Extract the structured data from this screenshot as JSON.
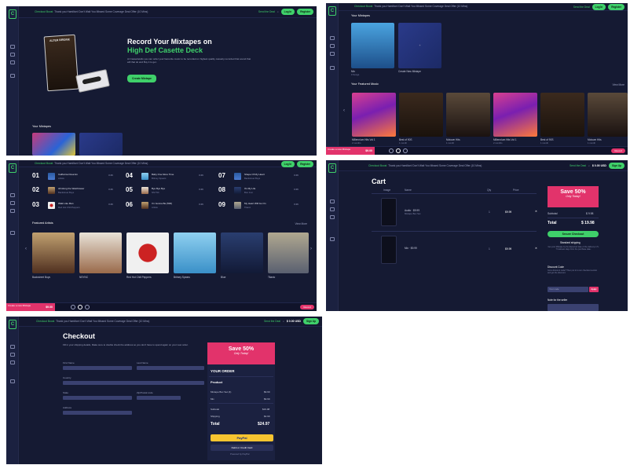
{
  "topbar": {
    "promo_prefix": "Checkout Boost",
    "promo_text": "Thank you Hamilton! Don't Wait You Missed Some Coverage Deal Offer (10 Mins)",
    "promo_long": "Checkout Boost · Thank you Hamilton! Don't Wait You Missed Some Coverage Deal Offer (10 Mins)",
    "link": "Send the Deal",
    "login": "Log In",
    "register": "Register",
    "currency": "$ 0.00 USD",
    "sign_up": "Sign Up"
  },
  "sidebar": {
    "logo": "C"
  },
  "screen1": {
    "album_title": "ALTER BRIDGE",
    "heading_line1": "Record Your Mixtapes on",
    "heading_line2": "High Def Casette Deck",
    "description": "At CassetteHits you can order your favourite music to be recorded on highest quality cassetty recorded that sound that will that do and Buy it to get.",
    "cta": "Create Mixtape",
    "your_mixtapes": "Your Mixtapes"
  },
  "screen2": {
    "your_mixtapes": "Your Mixtapes",
    "mixtape1_name": "Mix",
    "mixtape1_sub": "0 Songs",
    "create_label": "Create New Mixtape",
    "featured_title": "Your Featured Music",
    "view_more": "View More",
    "albums": [
      {
        "name": "Millennium Hits Vol 1",
        "sub": "2 months"
      },
      {
        "name": "Best of 90S",
        "sub": "1 month"
      },
      {
        "name": "Motown Hits",
        "sub": "1 month"
      },
      {
        "name": "Millennium Hits Vol 1",
        "sub": "2 months"
      },
      {
        "name": "Best of 90S",
        "sub": "1 month"
      },
      {
        "name": "Motown Hits",
        "sub": "1 month"
      }
    ],
    "player_label": "Create a new Mixtape",
    "player_price": "$9.00",
    "player_button": "Record"
  },
  "screen3": {
    "tracks": [
      {
        "num": "01",
        "title": "California Dreamin",
        "artist": "Artists"
      },
      {
        "num": "02",
        "title": "All Along the Watchtower",
        "artist": "Backstreet Boys"
      },
      {
        "num": "03",
        "title": "Walk Like Man",
        "artist": "Red Hot Chili Peppers"
      },
      {
        "num": "04",
        "title": "Baby One More Time",
        "artist": "Britney Spears"
      },
      {
        "num": "05",
        "title": "Bye Bye Bye",
        "artist": "NSYNC"
      },
      {
        "num": "06",
        "title": "I'm Gonna Be (500)",
        "artist": "Artists"
      },
      {
        "num": "07",
        "title": "Shape Of My Heart",
        "artist": "Backstreet Boys"
      },
      {
        "num": "08",
        "title": "It's My Life",
        "artist": "Bon Jovi"
      },
      {
        "num": "09",
        "title": "My Heart Will Go On",
        "artist": "Titanic"
      }
    ],
    "track_meta": "3:46",
    "featured_artists": "Featured Artists",
    "view_more": "View More",
    "artists": [
      "Backstreet Boys",
      "NSYNC",
      "Red Hot Chili Peppers",
      "Britney Spears",
      "Blue",
      "Titanic"
    ],
    "player_label": "Create a new Mixtape",
    "player_price": "$9.00",
    "player_button": "Record"
  },
  "screen4": {
    "title": "Cart",
    "col_image": "Image",
    "col_name": "Name",
    "col_qty": "Qty",
    "col_price": "Price",
    "items": [
      {
        "name": "Audio · $9.99",
        "sub": "Mixtape Box Set",
        "qty": "1",
        "price": "$9.99"
      },
      {
        "name": "Mix · $9.99",
        "sub": "",
        "qty": "1",
        "price": "$9.99"
      }
    ],
    "promo_big": "Save 50%",
    "promo_small": "Only Today!",
    "subtotal_label": "Subtotal",
    "subtotal_value": "$ 9.98",
    "total_label": "Total",
    "total_value": "$ 19.98",
    "checkout_button": "Secure Checkout",
    "shipping_title": "Standard shipping",
    "shipping_desc": "Get your Mixtape by the Expected date of the delivery in 5-7 business days from the purchase date.",
    "discount_title": "Discount Code",
    "discount_desc": "Got a discount code? Then put in to our checkout section and get the discount.",
    "discount_placeholder": "Your code",
    "discount_apply": "Apply",
    "note_title": "Note for the seller"
  },
  "screen5": {
    "title": "Checkout",
    "intro": "Fill in your shipping details, Make sure to double check the address so you don't have to spend again on your new order.",
    "labels": {
      "first_name": "First Name",
      "last_name": "Last Name",
      "country": "Country",
      "state": "State",
      "zip": "Zip/Postal code",
      "address": "Address"
    },
    "promo_big": "Save 50%",
    "promo_small": "Only Today!",
    "order_title": "YOUR ORDER",
    "product_label": "Product",
    "order_items": [
      {
        "name": "Mixtape Box Set (4)",
        "value": "$9.99"
      },
      {
        "name": "Mix",
        "value": "$9.99"
      }
    ],
    "subtotal_label": "Subtotal",
    "subtotal_value": "$19.98",
    "shipping_label": "Shipping",
    "shipping_value": "$4.99",
    "total_label": "Total",
    "total_value": "$24.97",
    "paypal": "PayPal",
    "card_button": "Debit or Credit Card",
    "powered": "Powered by PayPal"
  }
}
